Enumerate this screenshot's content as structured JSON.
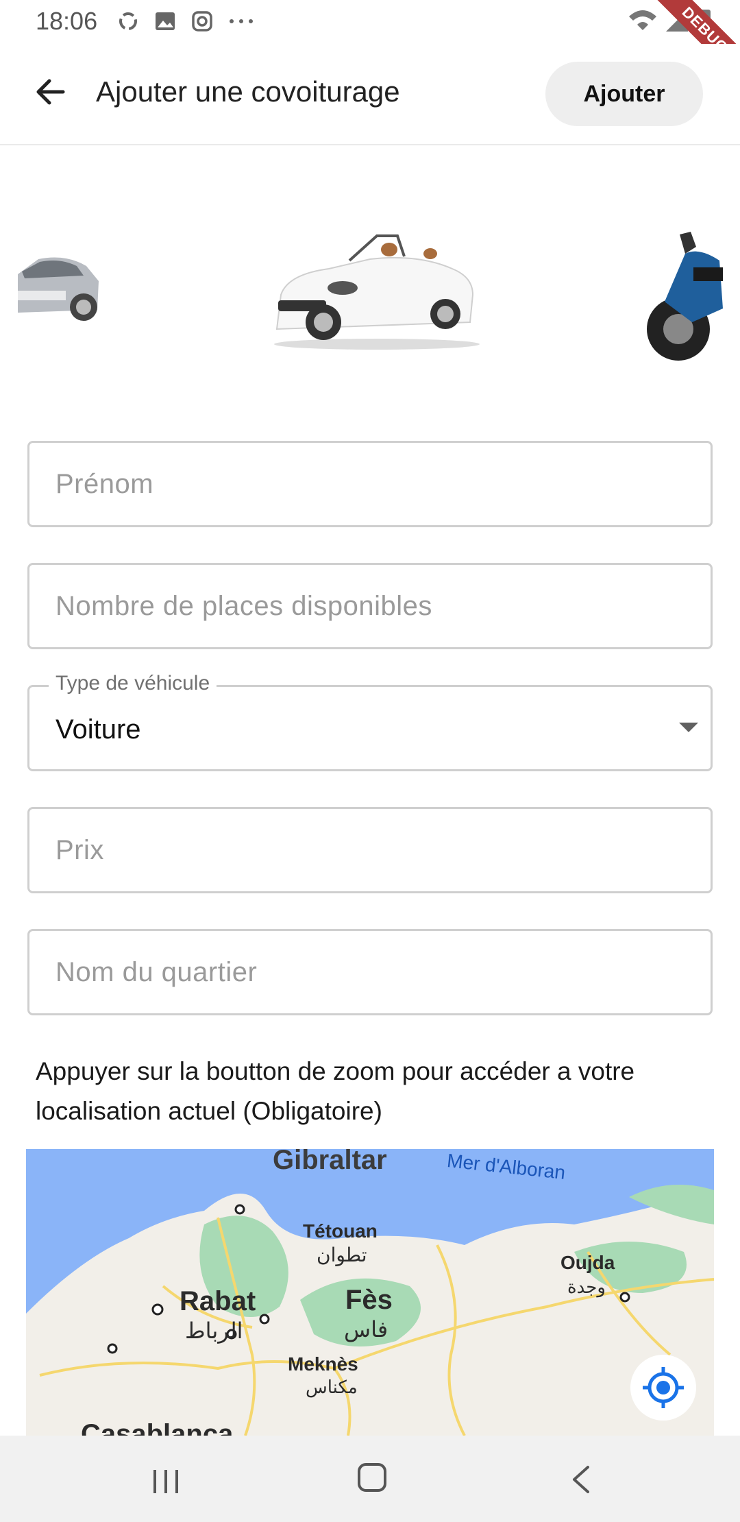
{
  "status_bar": {
    "time": "18:06",
    "icons": [
      "sync-icon",
      "image-icon",
      "instagram-icon",
      "more-icon"
    ],
    "right_icons": [
      "wifi-icon",
      "signal-icon",
      "battery-charging-icon"
    ],
    "debug_label": "DEBUG"
  },
  "app_bar": {
    "title": "Ajouter une covoiturage",
    "action_label": "Ajouter"
  },
  "carousel": {
    "items": [
      "sedan-car",
      "convertible-car",
      "motorcycle"
    ],
    "selected_index": 1
  },
  "form": {
    "first_name": {
      "placeholder": "Prénom"
    },
    "seats": {
      "placeholder": "Nombre de places disponibles"
    },
    "vehicle_type": {
      "label": "Type de véhicule",
      "value": "Voiture"
    },
    "price": {
      "placeholder": "Prix"
    },
    "neighborhood": {
      "placeholder": "Nom du quartier"
    }
  },
  "info_text": "Appuyer sur la boutton de zoom pour accéder a votre localisation actuel (Obligatoire)",
  "map": {
    "labels": {
      "gibraltar": "Gibraltar",
      "sea": "Mer d'Alboran",
      "tetouan": "Tétouan",
      "tetouan_ar": "تطوان",
      "rabat": "Rabat",
      "rabat_ar": "الرباط",
      "fes": "Fès",
      "fes_ar": "فاس",
      "oujda": "Oujda",
      "oujda_ar": "وجدة",
      "meknes": "Meknès",
      "meknes_ar": "مكناس",
      "casablanca": "Casablanca"
    },
    "colors": {
      "water": "#8ab4f8",
      "land": "#f2efe9",
      "green": "#a8dab5",
      "roads": "#f5d76e"
    }
  },
  "nav_bar": {
    "buttons": [
      "recent-apps",
      "home",
      "back"
    ]
  }
}
